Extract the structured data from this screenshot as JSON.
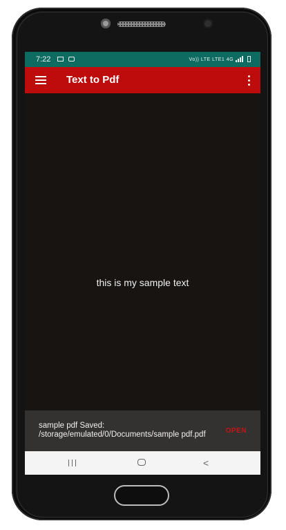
{
  "status_bar": {
    "time": "7:22",
    "network_label": "Vo)) LTE LTE1 4G"
  },
  "app_bar": {
    "title": "Text to Pdf"
  },
  "content": {
    "text": "this is my sample text"
  },
  "snackbar": {
    "message": "sample pdf Saved: /storage/emulated/0/Documents/sample pdf.pdf",
    "action_label": "OPEN"
  },
  "icons": {
    "menu": "hamburger-menu-icon",
    "overflow": "more-vertical-icon",
    "recents": "recents-icon",
    "home": "home-icon",
    "back": "back-icon"
  },
  "colors": {
    "status_bar": "#0d6b61",
    "app_bar": "#be0b0b",
    "background": "#171411",
    "snackbar": "#333230",
    "snackbar_action": "#c41414",
    "nav_bar": "#f4f4f4"
  }
}
